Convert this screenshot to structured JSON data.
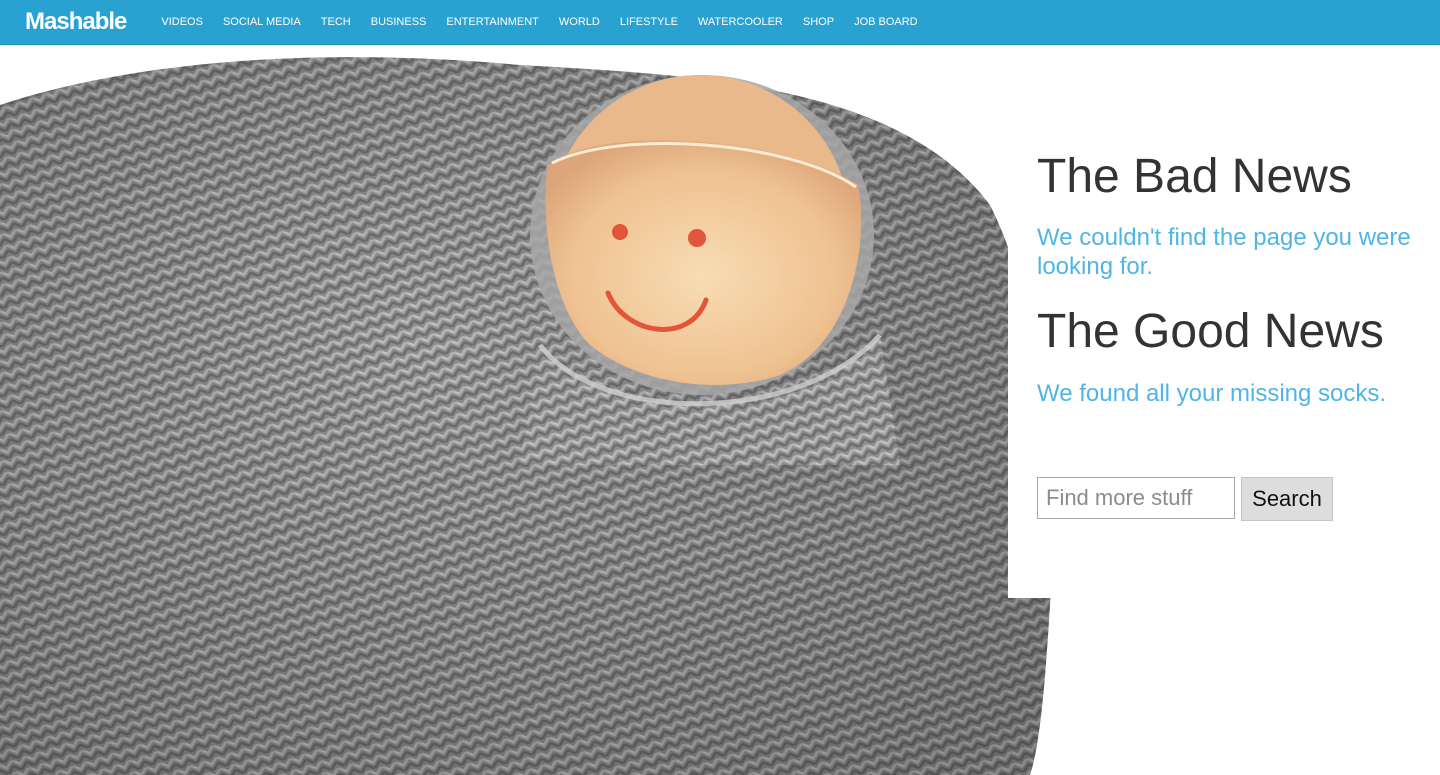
{
  "header": {
    "logo": "Mashable",
    "nav": [
      "VIDEOS",
      "SOCIAL MEDIA",
      "TECH",
      "BUSINESS",
      "ENTERTAINMENT",
      "WORLD",
      "LIFESTYLE",
      "WATERCOOLER",
      "SHOP",
      "JOB BOARD"
    ]
  },
  "content": {
    "bad_heading": "The Bad News",
    "bad_text": "We couldn't find the page you were looking for.",
    "good_heading": "The Good News",
    "good_text": "We found all your missing socks.",
    "search_placeholder": "Find more stuff",
    "search_button": "Search"
  },
  "hero_image": {
    "subject": "toe-through-sock-photo"
  },
  "colors": {
    "brand": "#29a2d2",
    "accent_text": "#4fb5e6",
    "heading_text": "#333333"
  }
}
